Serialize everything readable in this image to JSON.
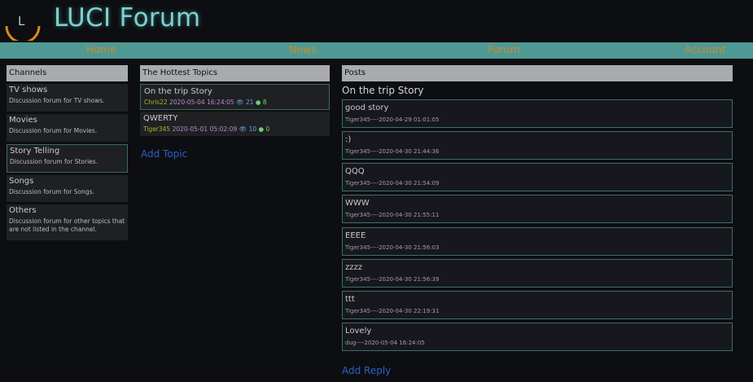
{
  "header": {
    "title": "LUCI Forum",
    "logo_letter": "L"
  },
  "nav": [
    "Home",
    "News",
    "Forum",
    "Account"
  ],
  "channels": {
    "header": "Channels",
    "items": [
      {
        "name": "TV shows",
        "desc": "Discussion forum for TV shows."
      },
      {
        "name": "Movies",
        "desc": "Discussion forum for Movies."
      },
      {
        "name": "Story Telling",
        "desc": "Discussion forum for Stories."
      },
      {
        "name": "Songs",
        "desc": "Discussion forum for Songs."
      },
      {
        "name": "Others",
        "desc": "Discussion forum for other topics that are not listed in the channel."
      }
    ]
  },
  "topics": {
    "header": "The Hottest Topics",
    "items": [
      {
        "title": "On the trip Story",
        "author": "Chris22",
        "date": "2020-05-04 16:24:05",
        "views": "21",
        "replies": "8"
      },
      {
        "title": "QWERTY",
        "author": "Tiger345",
        "date": "2020-05-01 05:02:09",
        "views": "10",
        "replies": "0"
      }
    ],
    "add_label": "Add Topic"
  },
  "posts": {
    "header": "Posts",
    "thread_title": "On the trip Story",
    "items": [
      {
        "text": "good story",
        "meta": "Tiger345----2020-04-29 01:01:05"
      },
      {
        "text": ":)",
        "meta": "Tiger345----2020-04-30 21:44:36"
      },
      {
        "text": "QQQ",
        "meta": "Tiger345----2020-04-30 21:54:09"
      },
      {
        "text": "WWW",
        "meta": "Tiger345----2020-04-30 21:55:11"
      },
      {
        "text": "EEEE",
        "meta": "Tiger345----2020-04-30 21:56:03"
      },
      {
        "text": "zzzz",
        "meta": "Tiger345----2020-04-30 21:56:39"
      },
      {
        "text": "ttt",
        "meta": "Tiger345----2020-04-30 22:19:31"
      },
      {
        "text": "Lovely",
        "meta": "dug----2020-05-04 16:24:05"
      }
    ],
    "add_label": "Add Reply"
  },
  "colors": {
    "brand": "#7fd0cf",
    "navbar": "#4f9994",
    "nav_text": "#d08a24",
    "link": "#2d5fc7",
    "logo_arc": "#d98a1e"
  }
}
